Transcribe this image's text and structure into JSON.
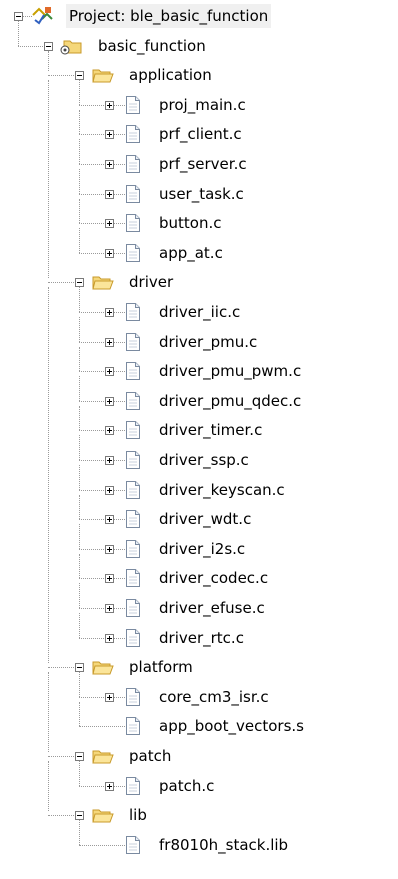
{
  "project": {
    "label": "Project: ble_basic_function",
    "target": {
      "label": "basic_function",
      "groups": [
        {
          "label": "application",
          "files": [
            {
              "name": "proj_main.c",
              "expandable": true
            },
            {
              "name": "prf_client.c",
              "expandable": true
            },
            {
              "name": "prf_server.c",
              "expandable": true
            },
            {
              "name": "user_task.c",
              "expandable": true
            },
            {
              "name": "button.c",
              "expandable": true
            },
            {
              "name": "app_at.c",
              "expandable": true
            }
          ]
        },
        {
          "label": "driver",
          "files": [
            {
              "name": "driver_iic.c",
              "expandable": true
            },
            {
              "name": "driver_pmu.c",
              "expandable": true
            },
            {
              "name": "driver_pmu_pwm.c",
              "expandable": true
            },
            {
              "name": "driver_pmu_qdec.c",
              "expandable": true
            },
            {
              "name": "driver_timer.c",
              "expandable": true
            },
            {
              "name": "driver_ssp.c",
              "expandable": true
            },
            {
              "name": "driver_keyscan.c",
              "expandable": true
            },
            {
              "name": "driver_wdt.c",
              "expandable": true
            },
            {
              "name": "driver_i2s.c",
              "expandable": true
            },
            {
              "name": "driver_codec.c",
              "expandable": true
            },
            {
              "name": "driver_efuse.c",
              "expandable": true
            },
            {
              "name": "driver_rtc.c",
              "expandable": true
            }
          ]
        },
        {
          "label": "platform",
          "files": [
            {
              "name": "core_cm3_isr.c",
              "expandable": true
            },
            {
              "name": "app_boot_vectors.s",
              "expandable": false
            }
          ]
        },
        {
          "label": "patch",
          "files": [
            {
              "name": "patch.c",
              "expandable": true
            }
          ]
        },
        {
          "label": "lib",
          "files": [
            {
              "name": "fr8010h_stack.lib",
              "expandable": false
            }
          ]
        }
      ]
    }
  },
  "icons": {
    "project": "project-icon",
    "target": "target-icon",
    "folder": "folder-open-icon",
    "file": "file-icon"
  },
  "colors": {
    "folder_fill": "#f5d77a",
    "folder_edge": "#c89a2a",
    "selection": "#f0f0f0",
    "tree_line": "#9a9a9a"
  }
}
